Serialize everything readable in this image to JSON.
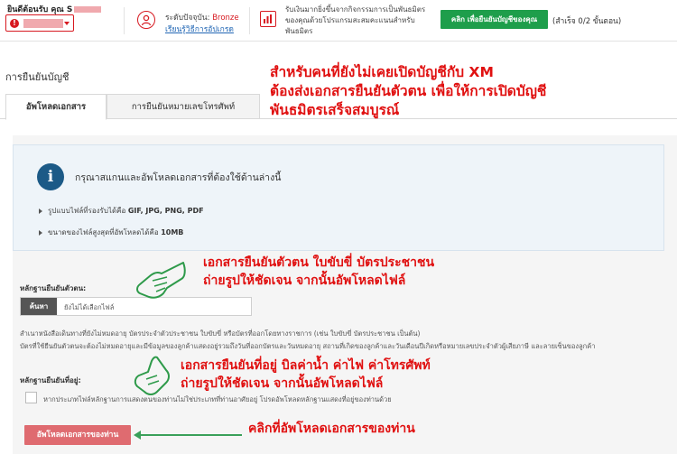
{
  "header": {
    "welcome": "ยินดีต้อนรับ คุณ S",
    "account_alert": "!",
    "status_label": "ระดับปัจจุบัน:",
    "status_value": "Bronze",
    "status_link": "เรียนรู้วิธีการอัปเกรด",
    "partner_text": "รับเงินมากยิ่งขึ้นจากกิจกรรมการเป็นพันธมิตรของคุณด้วยโปรแกรมสะสมคะแนนสำหรับพันธมิตร",
    "verify_button": "คลิก เพื่อยืนยันบัญชีของคุณ",
    "progress": "(สำเร็จ 0/2 ขั้นตอน)"
  },
  "page": {
    "title": "การยืนยันบัญชี",
    "tabs": [
      {
        "label": "อัพโหลดเอกสาร",
        "active": true
      },
      {
        "label": "การยืนยันหมายเลขโทรศัพท์",
        "active": false
      }
    ]
  },
  "info": {
    "icon": "info-icon",
    "title": "กรุณาสแกนและอัพโหลดเอกสารที่ต้องใช้ด้านล่างนี้",
    "formats_prefix": "รูปแบบไฟล์ที่รองรับได้คือ ",
    "formats": "GIF, JPG, PNG, PDF",
    "size_prefix": "ขนาดของไฟล์สูงสุดที่อัพโหลดได้คือ ",
    "size": "10MB"
  },
  "id_proof": {
    "label": "หลักฐานยืนยันตัวตน:",
    "browse": "ค้นหา",
    "placeholder": "ยังไม่ได้เลือกไฟล์",
    "note1": "สำเนาหนังสือเดินทางที่ยังไม่หมดอายุ บัตรประจำตัวประชาชน ใบขับขี่ หรือบัตรที่ออกโดยทางราชการ (เช่น ใบขับขี่ บัตรประชาชน เป็นต้น)",
    "note2": "บัตรที่ใช้ยืนยันตัวตนจะต้องไม่หมดอายุและมีข้อมูลของลูกค้าแสดงอยู่รวมถึงวันที่ออกบัตรและวันหมดอายุ สถานที่เกิดของลูกค้าและวันเดือนปีเกิดหรือหมายเลขประจำตัวผู้เสียภาษี และลายเซ็นของลูกค้า"
  },
  "address_proof": {
    "label": "หลักฐานยืนยันที่อยู่:",
    "checkbox_text": "หากประเภทไฟล์หลักฐานการแสดงตนของท่านไม่ใช่ประเภทที่ท่านอาศัยอยู่ โปรดอัพโหลดหลักฐานแสดงที่อยู่ของท่านด้วย"
  },
  "upload_button": "อัพโหลดเอกสารของท่าน",
  "annotations": {
    "top": [
      "สำหรับคนที่ยังไม่เคยเปิดบัญชีกับ XM",
      "ต้องส่งเอกสารยืนยันตัวตน เพื่อให้การเปิดบัญชี",
      "พันธมิตรเสร็จสมบูรณ์"
    ],
    "id": [
      "เอกสารยืนยันตัวตน ใบขับขี่ บัตรประชาชน",
      "ถ่ายรูปให้ชัดเจน จากนั้นอัพโหลดไฟล์"
    ],
    "address": [
      "เอกสารยืนยันที่อยู่ บิลค่าน้ำ ค่าไฟ ค่าโทรศัพท์",
      "ถ่ายรูปให้ชัดเจน จากนั้นอัพโหลดไฟล์"
    ],
    "click": "คลิกที่อัพโหลดเอกสารของท่าน"
  },
  "colors": {
    "accent_red": "#d71920",
    "annotation_red": "#e01010",
    "verify_green": "#1e9e4b",
    "info_icon_blue": "#1c5a87",
    "upload_button": "#df6b70"
  }
}
